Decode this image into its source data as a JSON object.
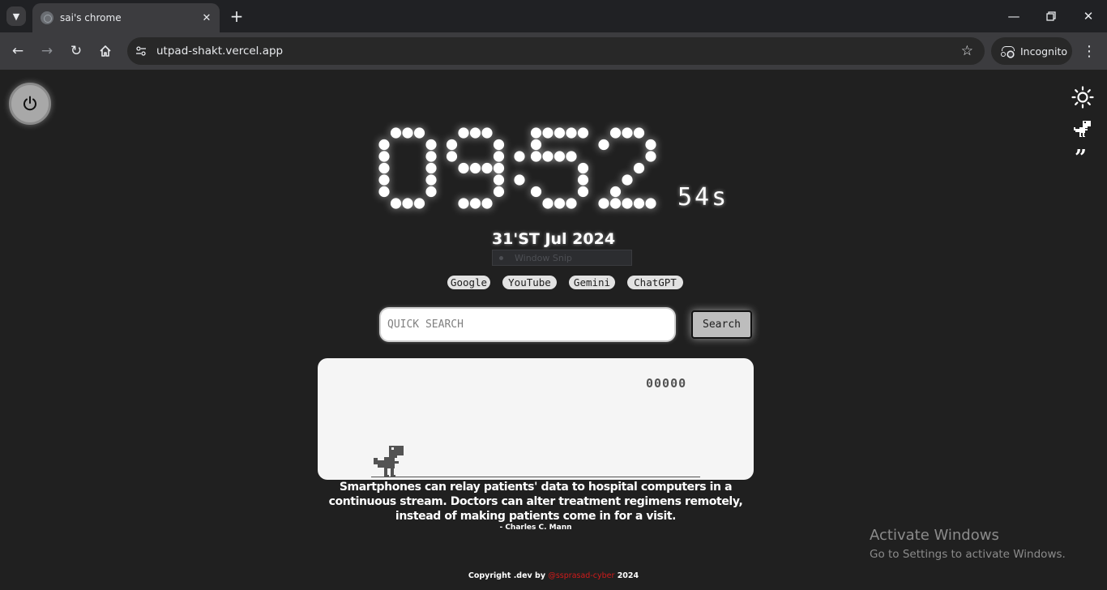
{
  "browser": {
    "tab_title": "sai's chrome",
    "url": "utpad-shakt.vercel.app",
    "incognito_label": "Incognito",
    "icons": [
      "tab-search-icon",
      "close-icon",
      "plus-icon",
      "minimize-icon",
      "restore-icon",
      "back-arrow-icon",
      "forward-arrow-icon",
      "reload-icon",
      "home-icon",
      "site-info-icon",
      "star-icon",
      "incognito-icon",
      "more-vert-icon"
    ]
  },
  "page": {
    "clock": {
      "hours": "09",
      "minutes": "52",
      "seconds": "54s"
    },
    "date": "31'ST Jul 2024",
    "snip_overlay": "Window Snip",
    "quick_links": [
      "Google",
      "YouTube",
      "Gemini",
      "ChatGPT"
    ],
    "search": {
      "placeholder": "QUICK SEARCH",
      "button_label": "Search"
    },
    "game": {
      "score": "00000"
    },
    "quote": {
      "text": "Smartphones can relay patients' data to hospital computers in a continuous stream. Doctors can alter treatment regimens remotely, instead of making patients come in for a visit.",
      "author": "- Charles C. Mann"
    },
    "footer": {
      "prefix": "Copyright .dev by",
      "handle": "@ssprasad-cyber",
      "year": "2024"
    },
    "icons": [
      "power-icon",
      "sun-icon",
      "dino-icon",
      "quote-icon"
    ]
  },
  "os_watermark": {
    "title": "Activate Windows",
    "subtitle": "Go to Settings to activate Windows."
  },
  "colors": {
    "background": "#202020",
    "chrome_bar": "#3c3c3f",
    "footer_handle": "#d11a1a"
  }
}
